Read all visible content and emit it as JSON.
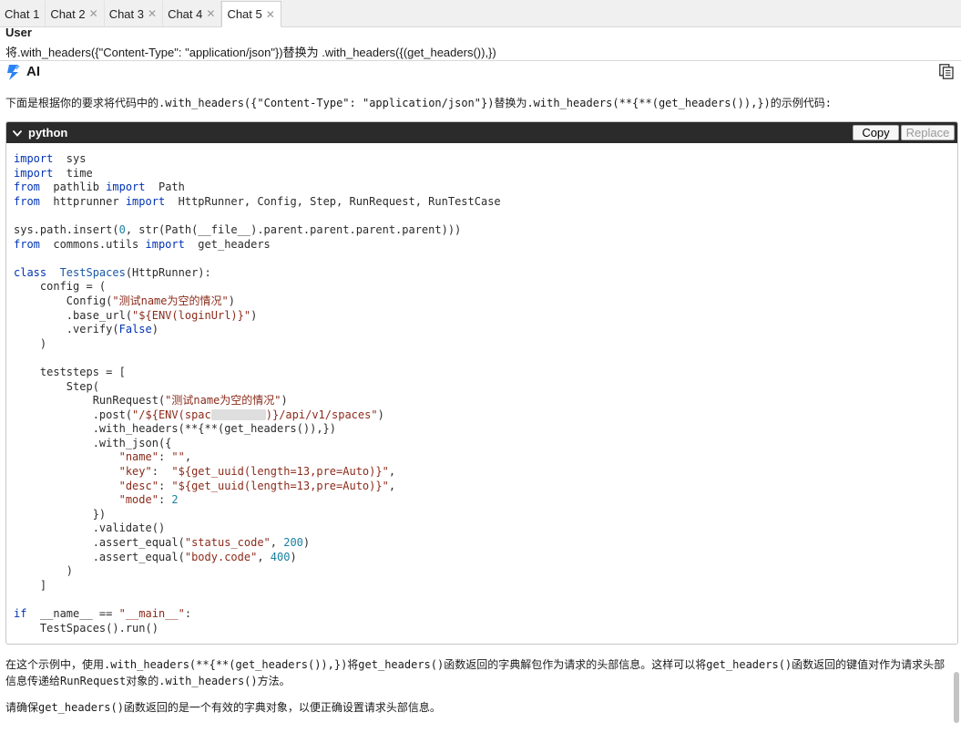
{
  "tabs": [
    {
      "label": "Chat 1",
      "closable": false,
      "active": false
    },
    {
      "label": "Chat 2",
      "closable": true,
      "active": false
    },
    {
      "label": "Chat 3",
      "closable": true,
      "active": false
    },
    {
      "label": "Chat 4",
      "closable": true,
      "active": false
    },
    {
      "label": "Chat 5",
      "closable": true,
      "active": true
    }
  ],
  "close_glyph": "✕",
  "user": {
    "role": "User",
    "message": "将.with_headers({\"Content-Type\": \"application/json\"})替换为 .with_headers({(get_headers()),})"
  },
  "assistant": {
    "role": "AI",
    "intro": "下面是根据你的要求将代码中的.with_headers({\"Content-Type\": \"application/json\"})替换为.with_headers(**{**(get_headers()),})的示例代码:"
  },
  "code_block": {
    "language": "python",
    "copy_label": "Copy",
    "replace_label": "Replace",
    "lines": [
      [
        [
          "kw",
          "import"
        ],
        [
          "",
          "  sys"
        ]
      ],
      [
        [
          "kw",
          "import"
        ],
        [
          "",
          "  time"
        ]
      ],
      [
        [
          "kw",
          "from"
        ],
        [
          "",
          "  pathlib "
        ],
        [
          "kw",
          "import"
        ],
        [
          "",
          "  Path"
        ]
      ],
      [
        [
          "kw",
          "from"
        ],
        [
          "",
          "  httprunner "
        ],
        [
          "kw",
          "import"
        ],
        [
          "",
          "  HttpRunner, Config, Step, RunRequest, RunTestCase"
        ]
      ],
      [],
      [
        [
          "",
          "sys.path.insert("
        ],
        [
          "num",
          "0"
        ],
        [
          "",
          ", str(Path(__file__).parent.parent.parent.parent)))"
        ]
      ],
      [
        [
          "kw",
          "from"
        ],
        [
          "",
          "  commons.utils "
        ],
        [
          "kw",
          "import"
        ],
        [
          "",
          "  get_headers"
        ]
      ],
      [],
      [
        [
          "kw",
          "class"
        ],
        [
          "",
          "  "
        ],
        [
          "cls",
          "TestSpaces"
        ],
        [
          "",
          "(HttpRunner):"
        ]
      ],
      [
        [
          "",
          "    config = ("
        ]
      ],
      [
        [
          "",
          "        Config("
        ],
        [
          "str",
          "\"测试name为空的情况\""
        ],
        [
          "",
          ")"
        ]
      ],
      [
        [
          "",
          "        .base_url("
        ],
        [
          "str",
          "\"${ENV(loginUrl)}\""
        ],
        [
          "",
          ")"
        ]
      ],
      [
        [
          "",
          "        .verify("
        ],
        [
          "kw",
          "False"
        ],
        [
          "",
          ")"
        ]
      ],
      [
        [
          "",
          "    )"
        ]
      ],
      [],
      [
        [
          "",
          "    teststeps = ["
        ]
      ],
      [
        [
          "",
          "        Step("
        ]
      ],
      [
        [
          "",
          "            RunRequest("
        ],
        [
          "str",
          "\"测试name为空的情况\""
        ],
        [
          "",
          ")"
        ]
      ],
      [
        [
          "",
          "            .post("
        ],
        [
          "str",
          "\"/${ENV(spac"
        ],
        [
          "blur",
          ""
        ],
        [
          "str",
          ")}/api/v1/spaces\""
        ],
        [
          "",
          ")"
        ]
      ],
      [
        [
          "",
          "            .with_headers(**{**(get_headers()),})"
        ]
      ],
      [
        [
          "",
          "            .with_json({"
        ]
      ],
      [
        [
          "",
          "                "
        ],
        [
          "str",
          "\"name\""
        ],
        [
          "",
          ": "
        ],
        [
          "str",
          "\"\""
        ],
        [
          "",
          ","
        ]
      ],
      [
        [
          "",
          "                "
        ],
        [
          "str",
          "\"key\""
        ],
        [
          "",
          ":  "
        ],
        [
          "str",
          "\"${get_uuid(length=13,pre=Auto)}\""
        ],
        [
          "",
          ","
        ]
      ],
      [
        [
          "",
          "                "
        ],
        [
          "str",
          "\"desc\""
        ],
        [
          "",
          ": "
        ],
        [
          "str",
          "\"${get_uuid(length=13,pre=Auto)}\""
        ],
        [
          "",
          ","
        ]
      ],
      [
        [
          "",
          "                "
        ],
        [
          "str",
          "\"mode\""
        ],
        [
          "",
          ": "
        ],
        [
          "num",
          "2"
        ]
      ],
      [
        [
          "",
          "            })"
        ]
      ],
      [
        [
          "",
          "            .validate()"
        ]
      ],
      [
        [
          "",
          "            .assert_equal("
        ],
        [
          "str",
          "\"status_code\""
        ],
        [
          "",
          ", "
        ],
        [
          "num",
          "200"
        ],
        [
          "",
          ")"
        ]
      ],
      [
        [
          "",
          "            .assert_equal("
        ],
        [
          "str",
          "\"body.code\""
        ],
        [
          "",
          ", "
        ],
        [
          "num",
          "400"
        ],
        [
          "",
          ")"
        ]
      ],
      [
        [
          "",
          "        )"
        ]
      ],
      [
        [
          "",
          "    ]"
        ]
      ],
      [],
      [
        [
          "kw",
          "if"
        ],
        [
          "",
          "  __name__ == "
        ],
        [
          "str",
          "\"__main__\""
        ],
        [
          "",
          ":"
        ]
      ],
      [
        [
          "",
          "    TestSpaces().run()"
        ]
      ]
    ]
  },
  "explanation": [
    "在这个示例中，使用.with_headers(**{**(get_headers()),})将get_headers()函数返回的字典解包作为请求的头部信息。这样可以将get_headers()函数返回的键值对作为请求头部信息传递给RunRequest对象的.with_headers()方法。",
    "请确保get_headers()函数返回的是一个有效的字典对象，以便正确设置请求头部信息。"
  ],
  "colors": {
    "accent": "#2b82f6",
    "code_header_bg": "#2b2b2b",
    "keyword": "#0033b3",
    "string": "#8b2b1b",
    "number": "#1a7fa0"
  }
}
